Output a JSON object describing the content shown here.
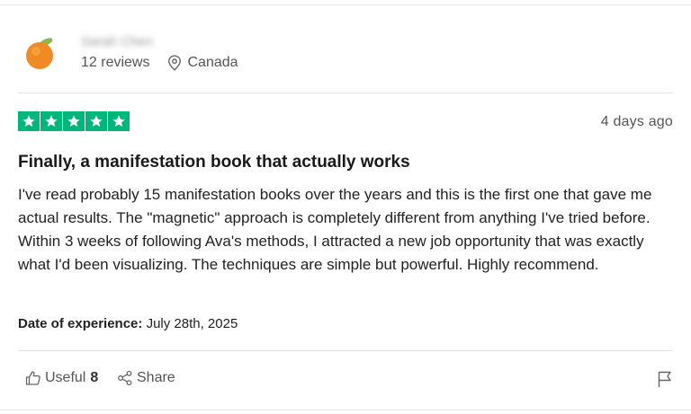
{
  "reviewer": {
    "name": "Sarah Chen",
    "review_count": "12 reviews",
    "location": "Canada",
    "avatar_icon": "orange-fruit-icon",
    "pin_icon": "location-pin-icon"
  },
  "review": {
    "rating": 5,
    "rating_max": 5,
    "star_color": "#00b67a",
    "posted": "4 days ago",
    "title": "Finally, a manifestation book that actually works",
    "body": "I've read probably 15 manifestation books over the years and this is the first one that gave me actual results. The \"magnetic\" approach is completely different from anything I've tried before. Within 3 weeks of following Ava's methods, I attracted a new job opportunity that was exactly what I'd been visualizing. The techniques are simple but powerful. Highly recommend.",
    "experience_label": "Date of experience:",
    "experience_date": "July 28th, 2025"
  },
  "actions": {
    "useful_label": "Useful",
    "useful_count": "8",
    "share_label": "Share",
    "useful_icon": "thumbs-up-icon",
    "share_icon": "share-icon",
    "flag_icon": "flag-icon"
  }
}
